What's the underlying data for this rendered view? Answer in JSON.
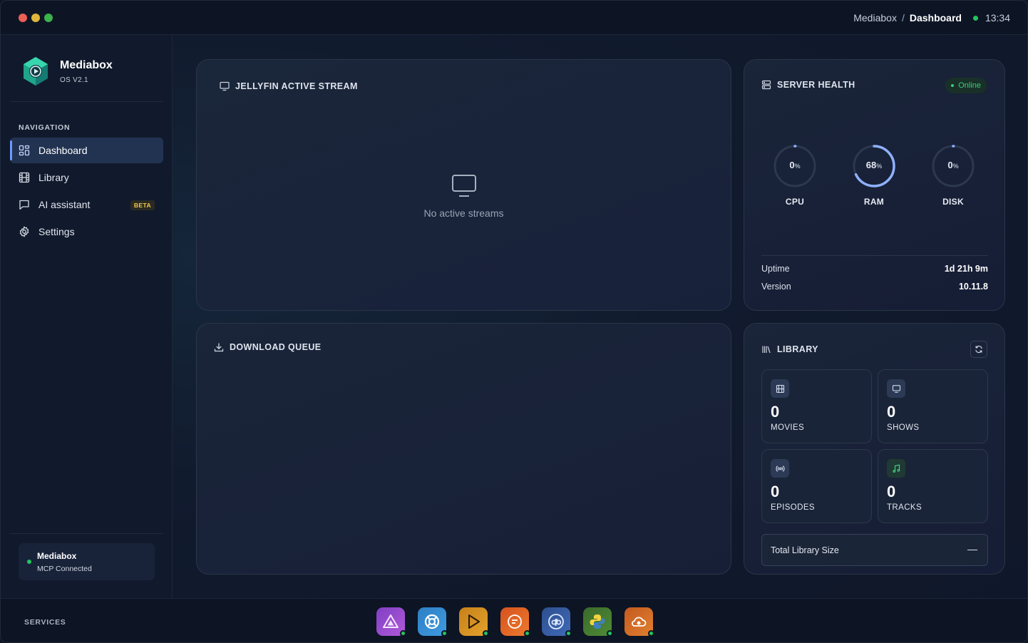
{
  "titlebar": {
    "breadcrumb_root": "Mediabox",
    "breadcrumb_sep": "/",
    "breadcrumb_current": "Dashboard",
    "time": "13:34",
    "status_color": "#22c55e"
  },
  "brand": {
    "name": "Mediabox",
    "version": "OS V2.1",
    "logo_icon": "mediabox-logo-icon"
  },
  "sidebar": {
    "heading": "NAVIGATION",
    "items": [
      {
        "label": "Dashboard",
        "icon": "grid-icon",
        "active": true
      },
      {
        "label": "Library",
        "icon": "film-icon"
      },
      {
        "label": "AI assistant",
        "icon": "chat-icon",
        "badge": "BETA"
      },
      {
        "label": "Settings",
        "icon": "gear-icon"
      }
    ],
    "mcp": {
      "name": "Mediabox",
      "status": "MCP Connected"
    }
  },
  "stream": {
    "title": "JELLYFIN ACTIVE STREAM",
    "empty_text": "No active streams"
  },
  "queue": {
    "title": "DOWNLOAD QUEUE"
  },
  "health": {
    "title": "SERVER HEALTH",
    "status": "Online",
    "gauges": [
      {
        "label": "CPU",
        "value": "0",
        "unit": "%",
        "fraction": 0.0
      },
      {
        "label": "RAM",
        "value": "68",
        "unit": "%",
        "fraction": 0.68
      },
      {
        "label": "DISK",
        "value": "0",
        "unit": "%",
        "fraction": 0.0
      }
    ],
    "uptime_label": "Uptime",
    "uptime_value": "1d 21h 9m",
    "version_label": "Version",
    "version_value": "10.11.8"
  },
  "library": {
    "title": "LIBRARY",
    "stats": [
      {
        "label": "MOVIES",
        "value": "0",
        "icon": "film-icon"
      },
      {
        "label": "SHOWS",
        "value": "0",
        "icon": "monitor-icon"
      },
      {
        "label": "EPISODES",
        "value": "0",
        "icon": "broadcast-icon"
      },
      {
        "label": "TRACKS",
        "value": "0",
        "icon": "music-note-icon"
      }
    ],
    "total_label": "Total Library Size",
    "total_value": "—"
  },
  "services": {
    "label": "SERVICES",
    "apps": [
      {
        "name": "prowlarr",
        "icon": "triangle-icon"
      },
      {
        "name": "jellyseerr",
        "icon": "lifebuoy-icon"
      },
      {
        "name": "jellyfin",
        "icon": "play-icon"
      },
      {
        "name": "bazarr",
        "icon": "subtitle-icon"
      },
      {
        "name": "qbittorrent",
        "icon": "qb-icon"
      },
      {
        "name": "python",
        "icon": "python-icon"
      },
      {
        "name": "cloud",
        "icon": "cloud-sync-icon"
      }
    ]
  },
  "colors": {
    "accent": "#6f98ff",
    "online": "#34d07a",
    "gauge_track": "#2c3850",
    "gauge_fill": "#8fb1ff"
  }
}
